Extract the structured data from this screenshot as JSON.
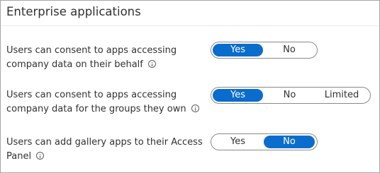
{
  "section": {
    "title": "Enterprise applications"
  },
  "settings": [
    {
      "label_lines": [
        "Users can consent to apps accessing",
        "company data on their behalf"
      ],
      "options": [
        "Yes",
        "No"
      ],
      "selected": "Yes"
    },
    {
      "label_lines": [
        "Users can consent to apps accessing",
        "company data for the groups they own"
      ],
      "options": [
        "Yes",
        "No",
        "Limited"
      ],
      "selected": "Yes"
    },
    {
      "label_lines": [
        "Users can add gallery apps to their Access",
        "Panel"
      ],
      "options": [
        "Yes",
        "No"
      ],
      "selected": "No"
    }
  ],
  "colors": {
    "accent": "#0a6ccc",
    "border": "#8a8886",
    "text": "#323130"
  },
  "icons": {
    "info": "info-icon"
  }
}
